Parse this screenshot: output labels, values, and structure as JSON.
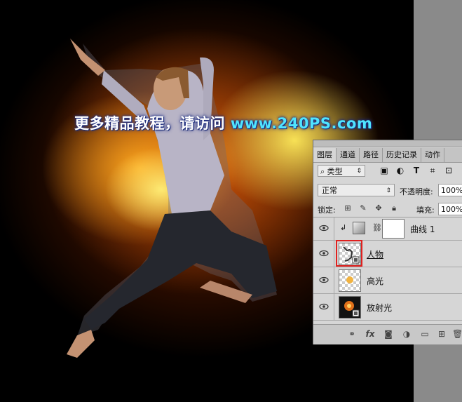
{
  "watermark": {
    "text": "更多精品教程，请访问",
    "url": "www.240PS.com"
  },
  "layers_panel": {
    "tabs": [
      "图层",
      "通道",
      "路径",
      "历史记录",
      "动作"
    ],
    "active_tab": "图层",
    "filter": {
      "label": "类型",
      "icon": "search-icon"
    },
    "filter_icons": [
      "image-filter-icon",
      "adjustment-filter-icon",
      "type-filter-icon",
      "shape-filter-icon",
      "smart-object-filter-icon"
    ],
    "blend_mode": "正常",
    "opacity_label": "不透明度:",
    "opacity_value": "100%",
    "lock_label": "锁定:",
    "fill_label": "填充:",
    "fill_value": "100%",
    "layers": [
      {
        "name": "曲线 1",
        "type": "adjustment",
        "visible": true,
        "clipped": true
      },
      {
        "name": "人物",
        "type": "smart-object",
        "visible": true,
        "selected_highlight": true
      },
      {
        "name": "高光",
        "type": "smart-object",
        "visible": true
      },
      {
        "name": "放射光",
        "type": "smart-object",
        "visible": true
      }
    ],
    "bottom_icons": [
      "link-icon",
      "fx-icon",
      "mask-icon",
      "adjustment-icon",
      "folder-icon",
      "new-layer-icon",
      "trash-icon"
    ],
    "highlight_color": "#e0201e"
  }
}
